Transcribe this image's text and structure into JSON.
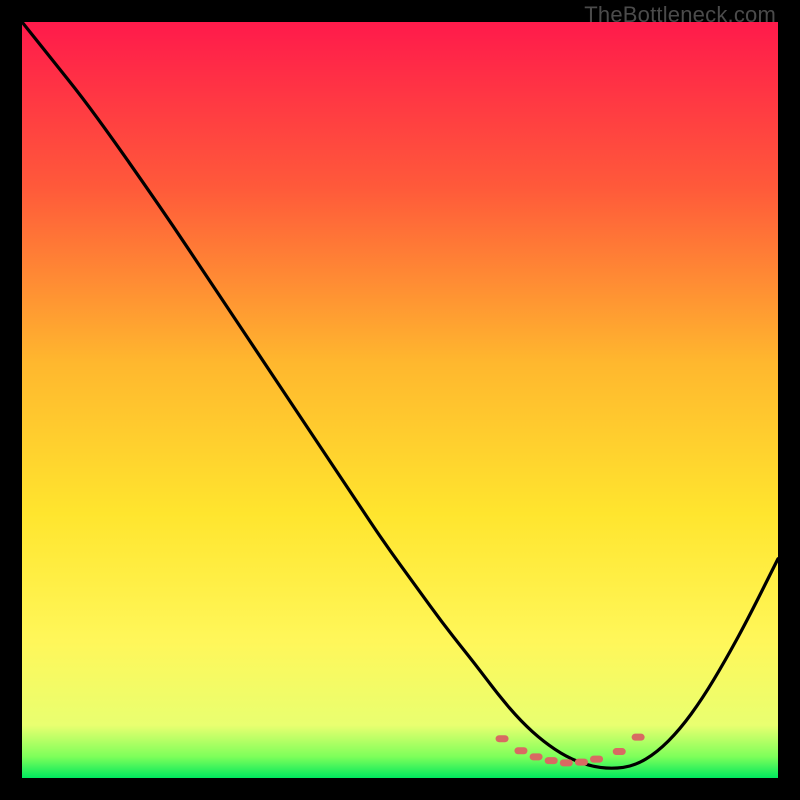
{
  "watermark": "TheBottleneck.com",
  "chart_data": {
    "type": "line",
    "title": "",
    "xlabel": "",
    "ylabel": "",
    "xlim": [
      0,
      100
    ],
    "ylim": [
      0,
      100
    ],
    "grid": false,
    "legend": false,
    "gradient_stops": [
      {
        "offset": 0.0,
        "color": "#ff1a4b"
      },
      {
        "offset": 0.22,
        "color": "#ff5a3a"
      },
      {
        "offset": 0.45,
        "color": "#ffb72e"
      },
      {
        "offset": 0.65,
        "color": "#ffe52e"
      },
      {
        "offset": 0.82,
        "color": "#fff75a"
      },
      {
        "offset": 0.93,
        "color": "#e9ff70"
      },
      {
        "offset": 0.972,
        "color": "#7dff5a"
      },
      {
        "offset": 1.0,
        "color": "#00e85e"
      }
    ],
    "series": [
      {
        "name": "bottleneck-curve",
        "x": [
          0,
          4,
          8,
          12,
          16,
          20,
          24,
          28,
          32,
          36,
          40,
          44,
          48,
          52,
          56,
          60,
          63,
          66,
          69,
          72,
          75,
          78,
          81,
          84,
          87,
          90,
          93,
          96,
          100
        ],
        "y": [
          100,
          95,
          90,
          84.5,
          78.8,
          73,
          67,
          61,
          55,
          49,
          43,
          37,
          31,
          25.5,
          20,
          15,
          11,
          7.5,
          4.8,
          2.8,
          1.6,
          1.2,
          1.6,
          3.4,
          6.4,
          10.5,
          15.5,
          21,
          29
        ]
      }
    ],
    "markers": {
      "name": "bottom-markers",
      "color": "#d86a62",
      "points_x": [
        63.5,
        66.0,
        68.0,
        70.0,
        72.0,
        74.0,
        76.0,
        79.0,
        81.5
      ],
      "points_y": [
        5.2,
        3.6,
        2.8,
        2.3,
        2.0,
        2.1,
        2.5,
        3.5,
        5.4
      ]
    }
  }
}
